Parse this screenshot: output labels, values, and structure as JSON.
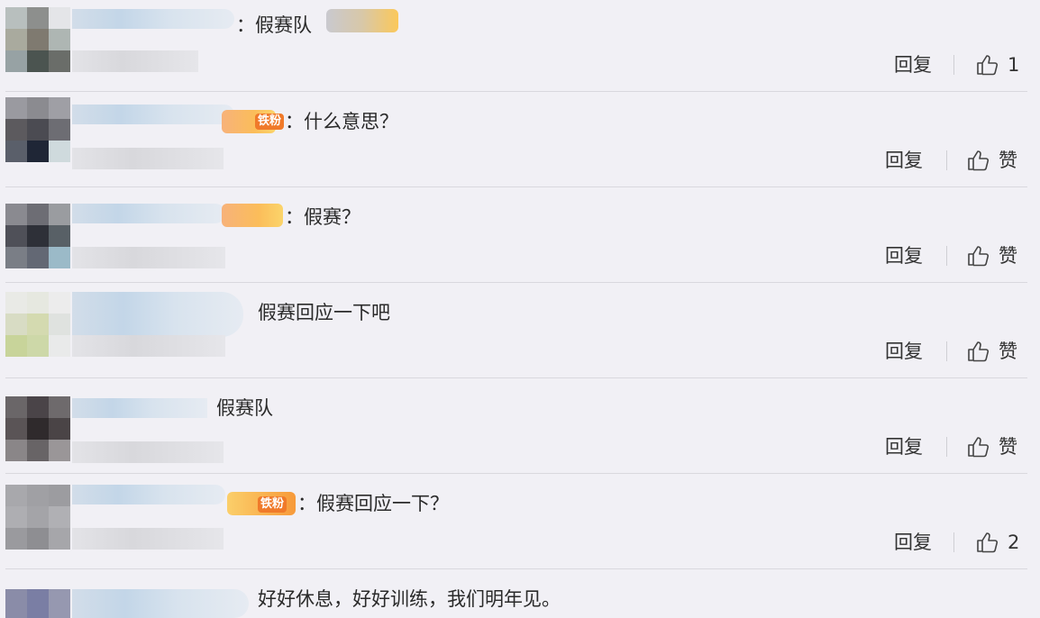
{
  "comments": [
    {
      "text": "：假赛队",
      "reply_label": "回复",
      "like_label": "1"
    },
    {
      "text": "：什么意思？",
      "reply_label": "回复",
      "like_label": "赞"
    },
    {
      "text": "：假赛？",
      "reply_label": "回复",
      "like_label": "赞"
    },
    {
      "text": "假赛回应一下吧",
      "reply_label": "回复",
      "like_label": "赞"
    },
    {
      "text": "假赛队",
      "reply_label": "回复",
      "like_label": "赞"
    },
    {
      "text": "：假赛回应一下？",
      "reply_label": "回复",
      "like_label": "2"
    },
    {
      "text": "好好休息，好好训练，我们明年见。"
    }
  ],
  "badges": {
    "fan_badge": "铁粉"
  },
  "icons": {
    "like": "thumbs-up-icon"
  },
  "colors": {
    "background": "#f1f0f5",
    "divider": "#d9d8de",
    "badge": "#fbbd5a"
  }
}
